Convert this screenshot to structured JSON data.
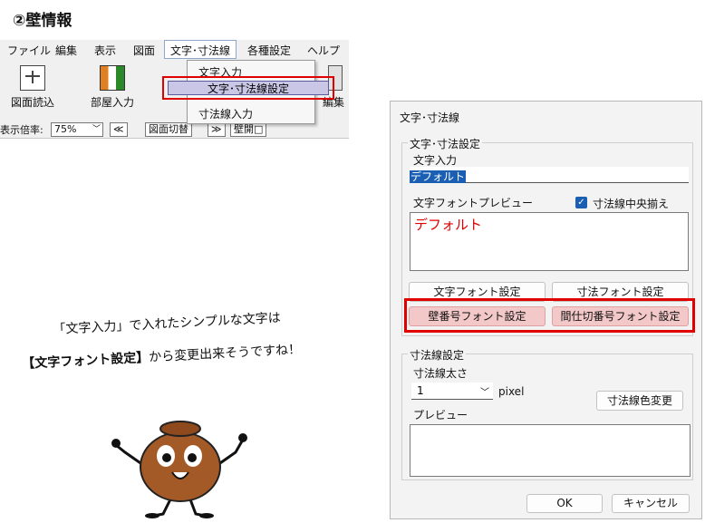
{
  "heading": "②壁情報",
  "app": {
    "menu": [
      "ファイル",
      "編集",
      "表示",
      "図面",
      "文字･寸法線",
      "各種設定",
      "ヘルプ"
    ],
    "tools": [
      "図面読込",
      "部屋入力",
      "編集"
    ],
    "status": {
      "zoom_label": "表示倍率:",
      "zoom_value": "75%",
      "prev": "≪",
      "switch": "図面切替",
      "next": "≫",
      "wall_toggle": "壁開□"
    },
    "dropdown": [
      "文字入力",
      "文字･寸法線設定",
      "寸法線入力"
    ]
  },
  "dialog": {
    "title": "文字･寸法線",
    "text_group": "文字･寸法設定",
    "text_input_label": "文字入力",
    "text_input_value": "デフォルト",
    "preview_label": "文字フォントプレビュー",
    "center_check": "寸法線中央揃え",
    "preview_text": "デフォルト",
    "btn_text_font": "文字フォント設定",
    "btn_dim_font": "寸法フォント設定",
    "btn_wall_font": "壁番号フォント設定",
    "btn_partition_font": "間仕切番号フォント設定",
    "dim_group": "寸法線設定",
    "thickness_label": "寸法線太さ",
    "thickness_value": "1",
    "thickness_unit": "pixel",
    "btn_color": "寸法線色変更",
    "dim_preview_label": "プレビュー",
    "ok": "OK",
    "cancel": "キャンセル"
  },
  "caption": {
    "line1": "「文字入力」で入れたシンプルな文字は",
    "line2_bold": "【文字フォント設定】",
    "line2_rest": "から変更出来そうですね！"
  },
  "colors": {
    "highlight": "#e00000",
    "preview_text": "#e00000",
    "check": "#1a5fb4",
    "btn_pink": "#f3c8c8"
  }
}
